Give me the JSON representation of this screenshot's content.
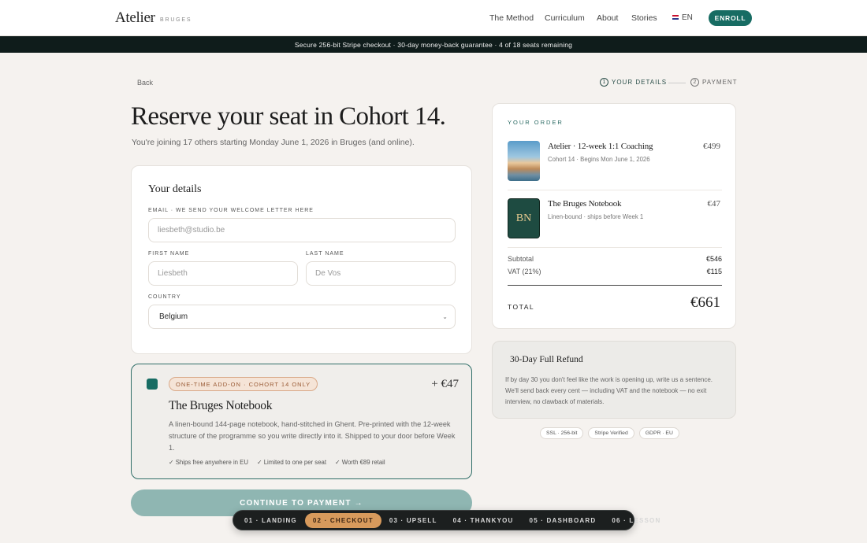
{
  "header": {
    "logo": "Atelier",
    "logo_mark": "®",
    "logo_city": "BRUGES",
    "nav": [
      "The Method",
      "Curriculum",
      "About",
      "Stories"
    ],
    "lang": "EN",
    "enroll": "ENROLL"
  },
  "banner": "Secure 256-bit Stripe checkout · 30-day money-back guarantee · 4 of 18 seats remaining",
  "steps": {
    "back": "Back",
    "s1_num": "1",
    "s1": "YOUR DETAILS",
    "s2_num": "2",
    "s2": "PAYMENT"
  },
  "hero": {
    "title": "Reserve your seat in Cohort 14.",
    "subtitle": "You're joining 17 others starting Monday June 1, 2026 in Bruges (and online)."
  },
  "details": {
    "title": "Your details",
    "email_label": "EMAIL · WE SEND YOUR WELCOME LETTER HERE",
    "email_placeholder": "liesbeth@studio.be",
    "first_label": "FIRST NAME",
    "first_placeholder": "Liesbeth",
    "last_label": "LAST NAME",
    "last_placeholder": "De Vos",
    "country_label": "COUNTRY",
    "country_value": "Belgium"
  },
  "addon": {
    "pill": "ONE-TIME ADD-ON · COHORT 14 ONLY",
    "price": "+ €47",
    "title": "The Bruges Notebook",
    "description": "A linen-bound 144-page notebook, hand-stitched in Ghent. Pre-printed with the 12-week structure of the programme so you write directly into it. Shipped to your door before Week 1.",
    "bullets": [
      "✓ Ships free anywhere in EU",
      "✓ Limited to one per seat",
      "✓ Worth €89 retail"
    ]
  },
  "cta": "CONTINUE TO PAYMENT →",
  "order": {
    "heading": "YOUR ORDER",
    "items": [
      {
        "title": "Atelier · 12-week 1:1 Coaching",
        "sub": "Cohort 14 · Begins Mon June 1, 2026",
        "price": "€499"
      },
      {
        "title": "The Bruges Notebook",
        "sub": "Linen-bound · ships before Week 1",
        "price": "€47",
        "thumb_text": "BN"
      }
    ],
    "subtotal_label": "Subtotal",
    "subtotal": "€546",
    "vat_label": "VAT (21%)",
    "vat": "€115",
    "total_label": "TOTAL",
    "total": "€661"
  },
  "refund": {
    "title": "30-Day Full Refund",
    "text": "If by day 30 you don't feel like the work is opening up, write us a sentence. We'll send back every cent — including VAT and the notebook — no exit interview, no clawback of materials."
  },
  "badges": [
    "SSL · 256-bit",
    "Stripe Verified",
    "GDPR · EU"
  ],
  "flow": [
    "01 · LANDING",
    "02 · CHECKOUT",
    "03 · UPSELL",
    "04 · THANKYOU",
    "05 · DASHBOARD",
    "06 · LESSON"
  ],
  "colors": {
    "accent": "#176c63",
    "banner": "#0f1c1b",
    "flow_active": "#d89a5c",
    "cta": "#8fb6b2"
  }
}
